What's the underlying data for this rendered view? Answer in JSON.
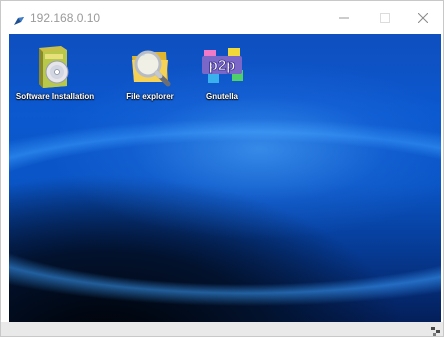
{
  "window": {
    "title": "192.168.0.10"
  },
  "titlebar_buttons": {
    "minimize_icon": "minimize-icon",
    "maximize_icon": "maximize-icon",
    "close_icon": "close-icon"
  },
  "desktop": {
    "icons": [
      {
        "label": "Software Installation",
        "icon": "software-box-icon"
      },
      {
        "label": "File explorer",
        "icon": "folder-magnifier-icon"
      },
      {
        "label": "Gnutella",
        "icon": "p2p-cubes-icon"
      }
    ]
  },
  "colors": {
    "desktop_top": "#0f4fbf",
    "desktop_bottom": "#041f5a",
    "statusbar": "#e9e9e9"
  }
}
